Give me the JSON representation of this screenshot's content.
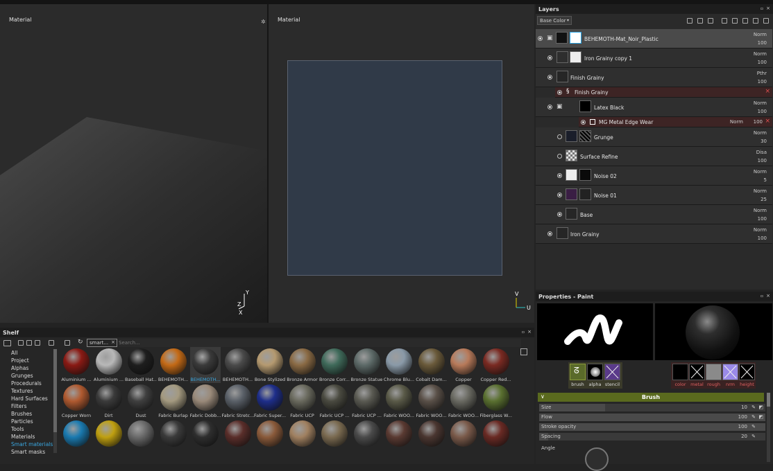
{
  "viewports": {
    "left_label": "Material",
    "right_label": "Material"
  },
  "layers": {
    "title": "Layers",
    "channel_select": "Base Color",
    "rows": [
      {
        "name": "BEHEMOTH-Mat_Noir_Plastic",
        "blend": "Norm",
        "opacity": "100"
      },
      {
        "name": "Iron Grainy copy 1",
        "blend": "Norm",
        "opacity": "100"
      },
      {
        "name": "Finish Grainy",
        "blend": "Pthr",
        "opacity": "100"
      },
      {
        "name": "Finish Grainy"
      },
      {
        "name": "Latex Black",
        "blend": "Norm",
        "opacity": "100"
      },
      {
        "name": "MG Metal Edge Wear",
        "blend": "Norm",
        "opacity": "100"
      },
      {
        "name": "Grunge",
        "blend": "Norm",
        "opacity": "30"
      },
      {
        "name": "Surface Refine",
        "blend": "Disa",
        "opacity": "100"
      },
      {
        "name": "Noise 02",
        "blend": "Norm",
        "opacity": "5"
      },
      {
        "name": "Noise 01",
        "blend": "Norm",
        "opacity": "25"
      },
      {
        "name": "Base",
        "blend": "Norm",
        "opacity": "100"
      },
      {
        "name": "Iron Grainy",
        "blend": "Norm",
        "opacity": "100"
      }
    ]
  },
  "properties": {
    "title": "Properties - Paint",
    "brush_channels": [
      "brush",
      "alpha",
      "stencil"
    ],
    "material_channels": [
      "color",
      "metal",
      "rough",
      "nrm",
      "height"
    ],
    "section": "Brush",
    "params": [
      {
        "label": "Size",
        "value": "10",
        "fill": 0.29
      },
      {
        "label": "Flow",
        "value": "100",
        "fill": 1.0
      },
      {
        "label": "Stroke opacity",
        "value": "100",
        "fill": 1.0
      },
      {
        "label": "Spacing",
        "value": "20",
        "fill": 0.04
      }
    ],
    "angle_label": "Angle"
  },
  "shelf": {
    "title": "Shelf",
    "search_tag": "smart...",
    "search_placeholder": "Search...",
    "categories": [
      "All",
      "Project",
      "Alphas",
      "Grunges",
      "Procedurals",
      "Textures",
      "Hard Surfaces",
      "Filters",
      "Brushes",
      "Particles",
      "Tools",
      "Materials",
      "Smart materials",
      "Smart masks"
    ],
    "active_category": "Smart materials",
    "row1": [
      "Aluminium ...",
      "Aluminium ...",
      "Baseball Hat...",
      "BEHEMOTH...",
      "BEHEMOTH...",
      "BEHEMOTH...",
      "Bone Stylized",
      "Bronze Armor",
      "Bronze Corr...",
      "Bronze Statue",
      "Chrome Blu...",
      "Cobalt Dam...",
      "Copper",
      "Copper Red..."
    ],
    "row2": [
      "Copper Worn",
      "Dirt",
      "Dust",
      "Fabric Burlap",
      "Fabric Dobb...",
      "Fabric Stretc...",
      "Fabric Super...",
      "Fabric UCP",
      "Fabric UCP ...",
      "Fabric UCP ...",
      "Fabric WOO...",
      "Fabric WOO...",
      "Fabric WOO...",
      "Fiberglass W..."
    ],
    "colors1": [
      "#8a1a14",
      "#b8b8b8",
      "#1e1e1e",
      "#c46a16",
      "#3a3a3a",
      "#4a4a4a",
      "#b59a70",
      "#8a6a44",
      "#3f6a5a",
      "#5d6a68",
      "#8a9aa8",
      "#6a5a3a",
      "#b87a5a",
      "#7a2a22"
    ],
    "colors2": [
      "#b05a30",
      "#3a3a3a",
      "#3f3f3f",
      "#a49a80",
      "#9a8a7a",
      "#5a6068",
      "#1e2e8a",
      "#6a6a5e",
      "#4a4a40",
      "#5a5a52",
      "#5a5a48",
      "#5a5048",
      "#6a6a62",
      "#5a7030"
    ],
    "colors3": [
      "#1a7ab0",
      "#c0a010",
      "#6a6a6a",
      "#3a3a3a",
      "#2e2e2e",
      "#5a2e2a",
      "#8a5a3a",
      "#a08060",
      "#7a6a50",
      "#4a4a4a",
      "#5a3a32",
      "#4a3630",
      "#7a5a4a",
      "#6a2a24"
    ]
  }
}
